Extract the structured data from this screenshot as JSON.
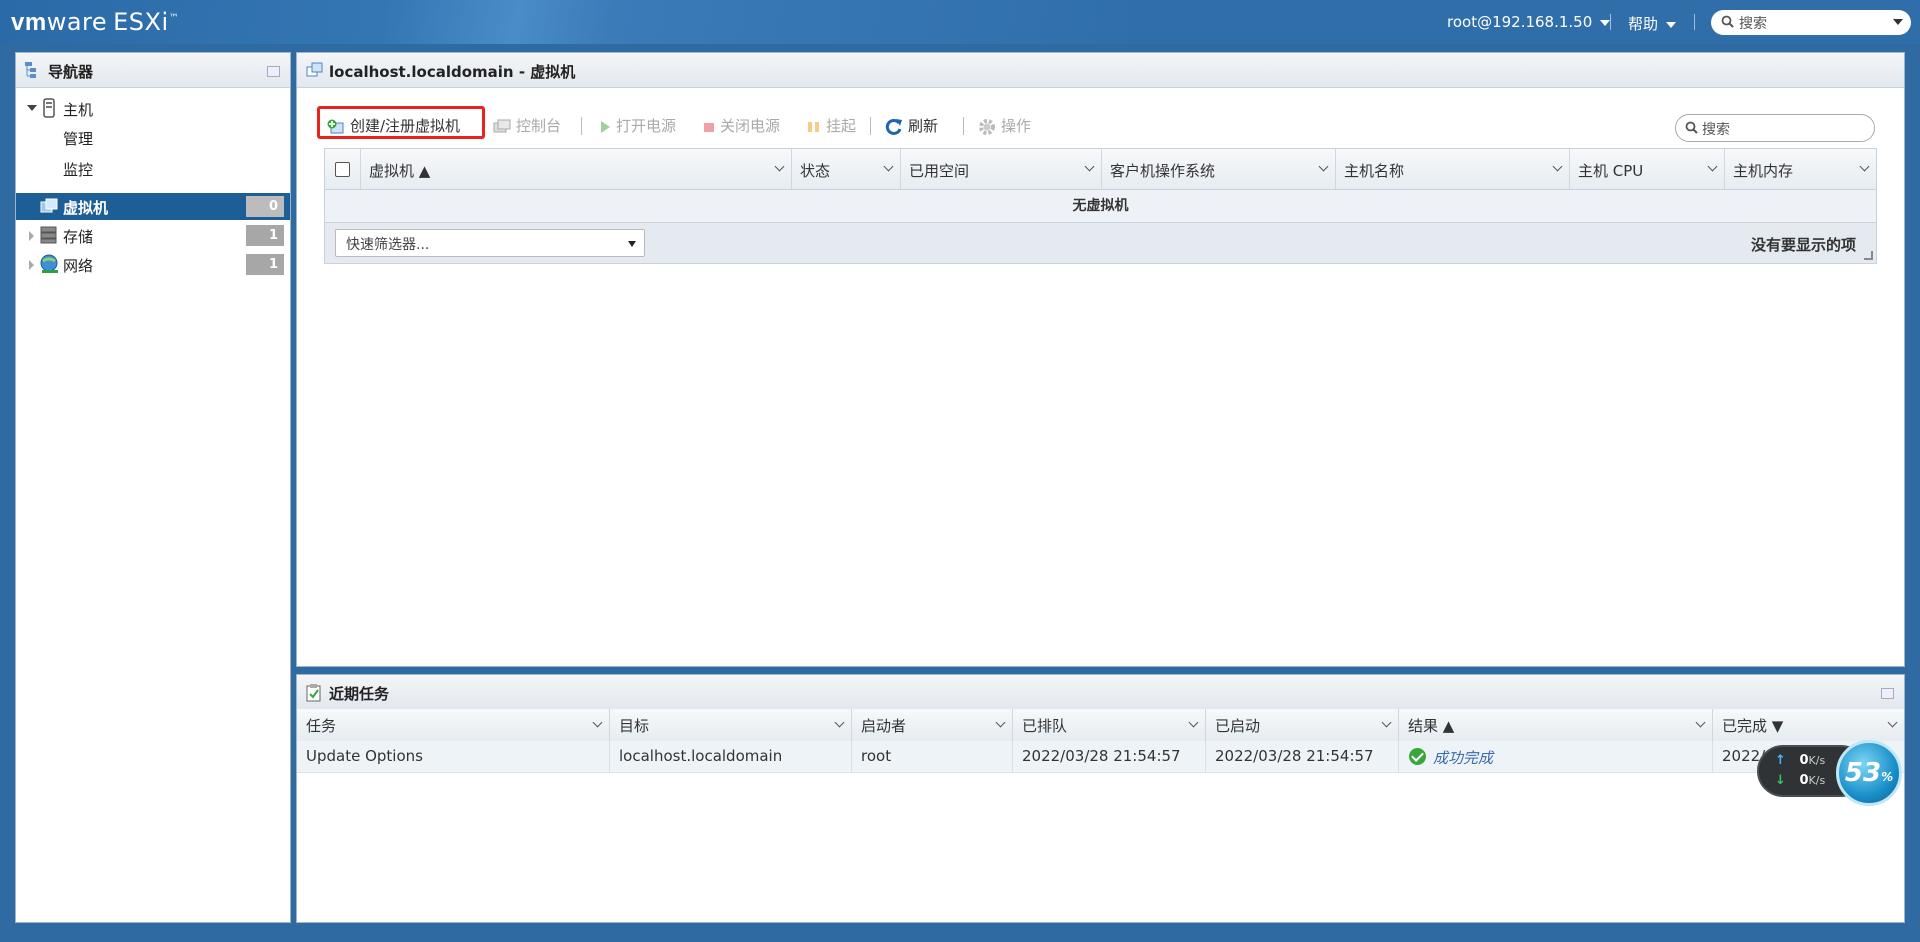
{
  "topbar": {
    "logo_vm": "vm",
    "logo_ware": "ware",
    "logo_esxi": "ESXi",
    "logo_tm": "™",
    "user": "root@192.168.1.50",
    "help": "帮助",
    "search_placeholder": "搜索"
  },
  "navigator": {
    "title": "导航器",
    "host": {
      "label": "主机",
      "children": [
        "管理",
        "监控"
      ]
    },
    "items": [
      {
        "label": "虚拟机",
        "count": "0",
        "selected": true
      },
      {
        "label": "存储",
        "count": "1"
      },
      {
        "label": "网络",
        "count": "1"
      }
    ]
  },
  "vm_panel": {
    "title": "localhost.localdomain - 虚拟机",
    "toolbar": {
      "create": "创建/注册虚拟机",
      "console": "控制台",
      "power_on": "打开电源",
      "power_off": "关闭电源",
      "suspend": "挂起",
      "refresh": "刷新",
      "actions": "操作"
    },
    "search_placeholder": "搜索",
    "columns": [
      "虚拟机 ▲",
      "状态",
      "已用空间",
      "客户机操作系统",
      "主机名称",
      "主机 CPU",
      "主机内存"
    ],
    "empty_message": "无虚拟机",
    "quick_filter": "快速筛选器...",
    "no_items": "没有要显示的项"
  },
  "tasks_panel": {
    "title": "近期任务",
    "columns": [
      "任务",
      "目标",
      "启动者",
      "已排队",
      "已启动",
      "结果 ▲",
      "已完成 ▼"
    ],
    "rows": [
      {
        "task": "Update Options",
        "target": "localhost.localdomain",
        "initiator": "root",
        "queued": "2022/03/28 21:54:57",
        "started": "2022/03/28 21:54:57",
        "result": "成功完成",
        "completed": "2022/0"
      }
    ]
  },
  "net_widget": {
    "up_value": "0",
    "up_unit": "K/s",
    "down_value": "0",
    "down_unit": "K/s",
    "badge": "53",
    "badge_suffix": "%"
  },
  "colors": {
    "topbar": "#2f6ea9",
    "selected_nav": "#1d5e97",
    "highlight_box": "#e8231f",
    "success": "#3aa63a"
  }
}
